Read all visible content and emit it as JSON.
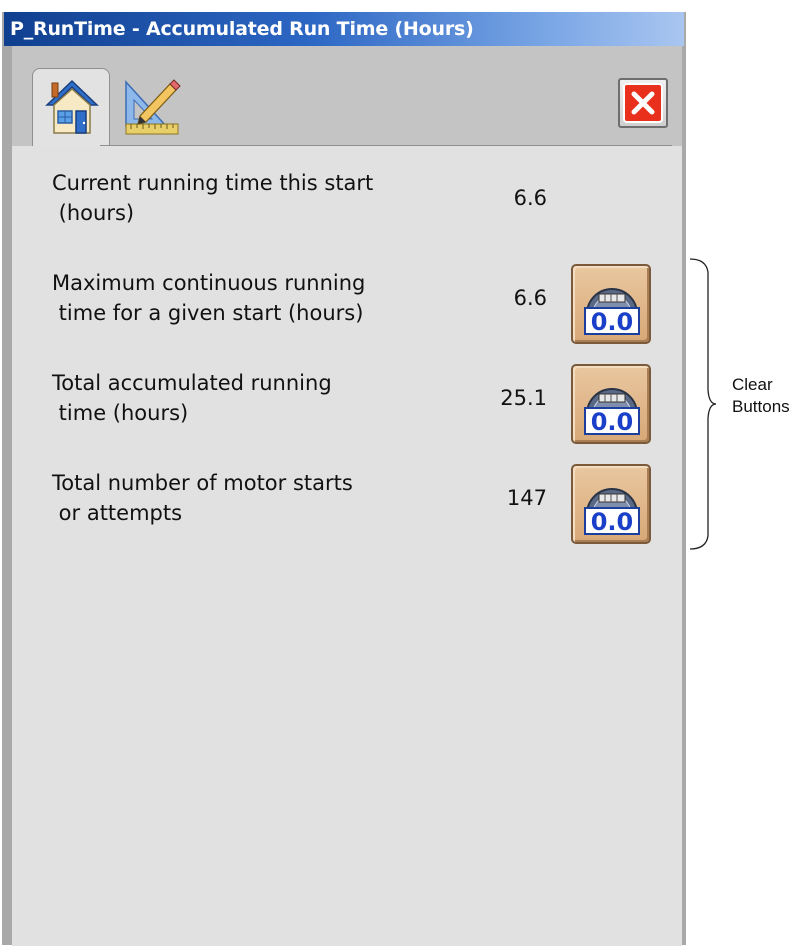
{
  "window": {
    "title": "P_RunTime - Accumulated Run Time (Hours)"
  },
  "tabs": [
    {
      "icon": "home-icon",
      "selected": true
    },
    {
      "icon": "engineering-icon",
      "selected": false
    }
  ],
  "close_button": {
    "icon": "close-icon",
    "color": "#e8301c"
  },
  "rows": [
    {
      "label": "Current running time this start\n (hours)",
      "value": "6.6",
      "has_clear": false
    },
    {
      "label": "Maximum continuous running\n time for a given start (hours)",
      "value": "6.6",
      "has_clear": true,
      "button_text": "0.0"
    },
    {
      "label": "Total accumulated running\n time (hours)",
      "value": "25.1",
      "has_clear": true,
      "button_text": "0.0"
    },
    {
      "label": "Total number of motor starts\n or attempts",
      "value": "147",
      "has_clear": true,
      "button_text": "0.0"
    }
  ],
  "annotation": {
    "line1": "Clear",
    "line2": "Buttons"
  }
}
